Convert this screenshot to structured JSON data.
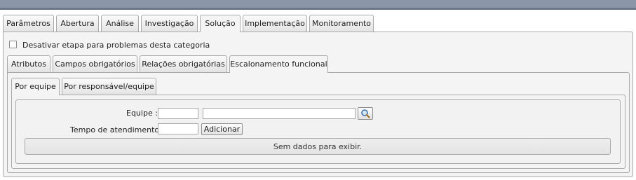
{
  "main_tabs": [
    {
      "label": "Parâmetros"
    },
    {
      "label": "Abertura"
    },
    {
      "label": "Análise"
    },
    {
      "label": "Investigação"
    },
    {
      "label": "Solução"
    },
    {
      "label": "Implementação"
    },
    {
      "label": "Monitoramento"
    }
  ],
  "active_main_tab": "Solução",
  "disable_step": {
    "label": "Desativar etapa para problemas desta categoria",
    "checked": false
  },
  "sub_tabs": [
    {
      "label": "Atributos"
    },
    {
      "label": "Campos obrigatórios"
    },
    {
      "label": "Relações obrigatórias"
    },
    {
      "label": "Escalonamento funcional"
    }
  ],
  "active_sub_tab": "Escalonamento funcional",
  "escalation_tabs": [
    {
      "label": "Por equipe"
    },
    {
      "label": "Por responsável/equipe"
    }
  ],
  "active_escalation_tab": "Por equipe",
  "form": {
    "team_label": "Equipe :",
    "team_code_value": "",
    "team_name_value": "",
    "time_label": "Tempo de atendimento :",
    "time_value": "",
    "add_button": "Adicionar"
  },
  "grid": {
    "empty_message": "Sem dados para exibir."
  },
  "icons": {
    "search": "magnifier-icon"
  }
}
